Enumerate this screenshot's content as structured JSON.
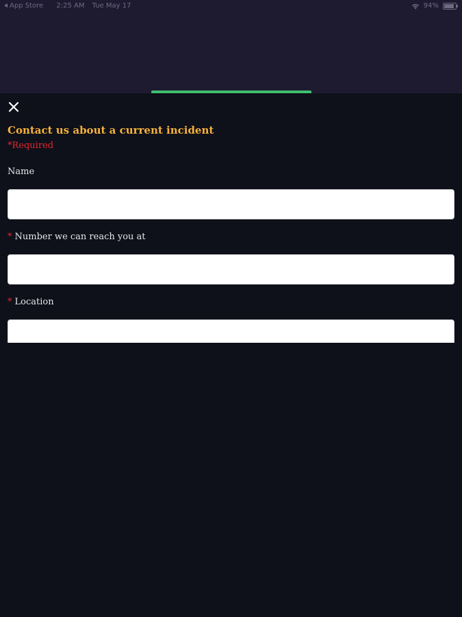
{
  "status_bar": {
    "back_app": "App Store",
    "time": "2:25 AM",
    "date": "Tue May 17",
    "battery": "94%"
  },
  "form": {
    "title": "Contact us about a current incident",
    "required_note": "*Required",
    "fields": [
      {
        "label": "Name",
        "required": false,
        "value": "",
        "placeholder": ""
      },
      {
        "label": "Number we can reach you at",
        "required": true,
        "value": "",
        "placeholder": ""
      },
      {
        "label": "Location",
        "required": true,
        "value": "",
        "placeholder": ""
      }
    ],
    "required_marker": "*"
  },
  "colors": {
    "backdrop": "#1e1b31",
    "sheet": "#0e101a",
    "title": "#f6b23a",
    "required": "#e8262a",
    "accent": "#3fbf6f"
  },
  "icons": {
    "close": "close-icon",
    "wifi": "wifi-icon",
    "battery": "battery-icon"
  }
}
